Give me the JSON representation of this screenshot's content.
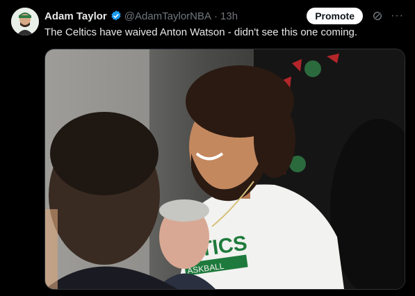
{
  "tweet": {
    "author_name": "Adam Taylor",
    "handle": "@AdamTaylorNBA",
    "separator": "·",
    "timestamp": "13h",
    "text": "The Celtics have waived Anton Watson - didn't see this one coming.",
    "promote_label": "Promote",
    "more_label": "···",
    "image": {
      "shirt_text_line1": "LTICS",
      "shirt_text_line2": "ASKBALL"
    }
  },
  "colors": {
    "background": "#000000",
    "verified": "#1d9bf0",
    "muted": "#71767b",
    "celtics_green": "#1e7a3c"
  },
  "icons": [
    "avatar",
    "verified-badge-icon",
    "grok-icon",
    "more-icon"
  ]
}
